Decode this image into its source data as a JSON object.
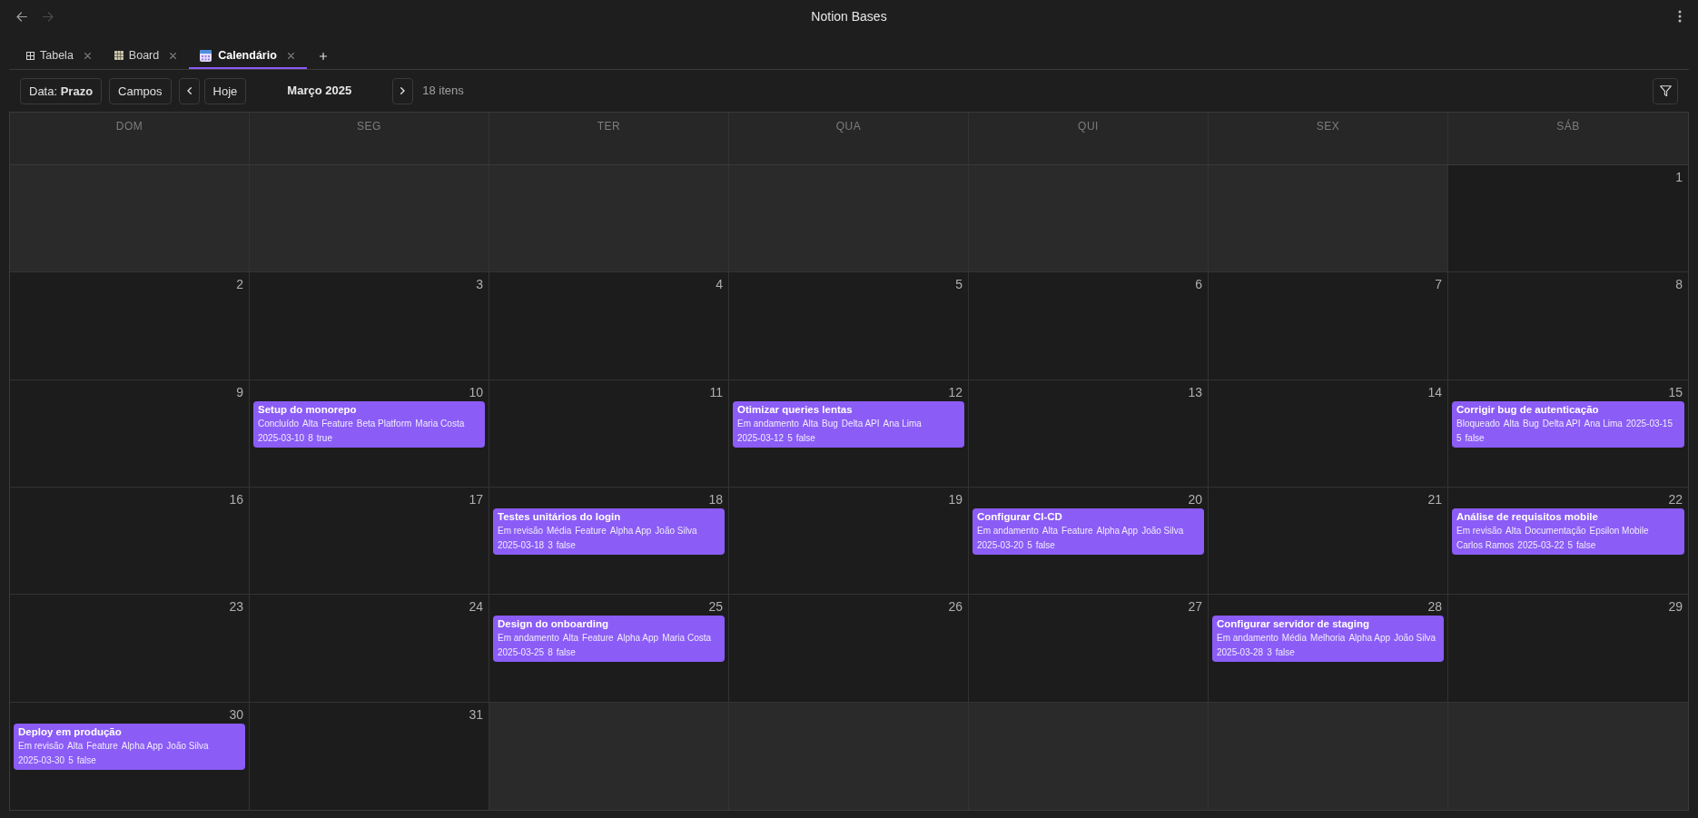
{
  "window": {
    "title": "Notion Bases"
  },
  "navigation": {
    "back": {
      "disabled": false
    },
    "forward": {
      "disabled": true
    }
  },
  "tabs": [
    {
      "label": "Tabela",
      "kind": "table",
      "selected": false
    },
    {
      "label": "Board",
      "kind": "board",
      "selected": false
    },
    {
      "label": "Calendário",
      "kind": "calendar",
      "selected": true
    }
  ],
  "toolbar": {
    "date_property_button": "Data: **Prazo**",
    "fields_button": "Campos",
    "today_button": "Hoje",
    "month_label": "Março 2025",
    "item_count": "18 itens"
  },
  "calendar": {
    "weekdays": [
      "DOM",
      "SEG",
      "TER",
      "QUA",
      "QUI",
      "SEX",
      "SÁB"
    ],
    "weeks": [
      [
        {
          "in_month": false
        },
        {
          "in_month": false
        },
        {
          "in_month": false
        },
        {
          "in_month": false
        },
        {
          "in_month": false
        },
        {
          "in_month": false
        },
        {
          "in_month": true,
          "day": "1"
        }
      ],
      [
        {
          "in_month": true,
          "day": "2"
        },
        {
          "in_month": true,
          "day": "3"
        },
        {
          "in_month": true,
          "day": "4"
        },
        {
          "in_month": true,
          "day": "5"
        },
        {
          "in_month": true,
          "day": "6"
        },
        {
          "in_month": true,
          "day": "7"
        },
        {
          "in_month": true,
          "day": "8"
        }
      ],
      [
        {
          "in_month": true,
          "day": "9"
        },
        {
          "in_month": true,
          "day": "10",
          "events": [
            {
              "title": "Setup do monorepo",
              "properties": [
                "Concluído",
                "Alta",
                "Feature",
                "Beta Platform",
                "Maria Costa",
                "2025-03-10",
                "8",
                "true"
              ]
            }
          ]
        },
        {
          "in_month": true,
          "day": "11"
        },
        {
          "in_month": true,
          "day": "12",
          "events": [
            {
              "title": "Otimizar queries lentas",
              "properties": [
                "Em andamento",
                "Alta",
                "Bug",
                "Delta API",
                "Ana Lima",
                "2025-03-12",
                "5",
                "false"
              ]
            }
          ]
        },
        {
          "in_month": true,
          "day": "13"
        },
        {
          "in_month": true,
          "day": "14"
        },
        {
          "in_month": true,
          "day": "15",
          "events": [
            {
              "title": "Corrigir bug de autenticação",
              "properties": [
                "Bloqueado",
                "Alta",
                "Bug",
                "Delta API",
                "Ana Lima",
                "2025-03-15",
                "5",
                "false"
              ]
            }
          ]
        }
      ],
      [
        {
          "in_month": true,
          "day": "16"
        },
        {
          "in_month": true,
          "day": "17"
        },
        {
          "in_month": true,
          "day": "18",
          "events": [
            {
              "title": "Testes unitários do login",
              "properties": [
                "Em revisão",
                "Média",
                "Feature",
                "Alpha App",
                "João Silva",
                "2025-03-18",
                "3",
                "false"
              ]
            }
          ]
        },
        {
          "in_month": true,
          "day": "19"
        },
        {
          "in_month": true,
          "day": "20",
          "events": [
            {
              "title": "Configurar CI-CD",
              "properties": [
                "Em andamento",
                "Alta",
                "Feature",
                "Alpha App",
                "João Silva",
                "2025-03-20",
                "5",
                "false"
              ]
            }
          ]
        },
        {
          "in_month": true,
          "day": "21"
        },
        {
          "in_month": true,
          "day": "22",
          "events": [
            {
              "title": "Análise de requisitos mobile",
              "properties": [
                "Em revisão",
                "Alta",
                "Documentação",
                "Epsilon Mobile",
                "Carlos Ramos",
                "2025-03-22",
                "5",
                "false"
              ]
            }
          ]
        }
      ],
      [
        {
          "in_month": true,
          "day": "23"
        },
        {
          "in_month": true,
          "day": "24"
        },
        {
          "in_month": true,
          "day": "25",
          "events": [
            {
              "title": "Design do onboarding",
              "properties": [
                "Em andamento",
                "Alta",
                "Feature",
                "Alpha App",
                "Maria Costa",
                "2025-03-25",
                "8",
                "false"
              ]
            }
          ]
        },
        {
          "in_month": true,
          "day": "26"
        },
        {
          "in_month": true,
          "day": "27"
        },
        {
          "in_month": true,
          "day": "28",
          "events": [
            {
              "title": "Configurar servidor de staging",
              "properties": [
                "Em andamento",
                "Média",
                "Melhoria",
                "Alpha App",
                "João Silva",
                "2025-03-28",
                "3",
                "false"
              ]
            }
          ]
        },
        {
          "in_month": true,
          "day": "29"
        }
      ],
      [
        {
          "in_month": true,
          "day": "30",
          "events": [
            {
              "title": "Deploy em produção",
              "properties": [
                "Em revisão",
                "Alta",
                "Feature",
                "Alpha App",
                "João Silva",
                "2025-03-30",
                "5",
                "false"
              ]
            }
          ]
        },
        {
          "in_month": true,
          "day": "31"
        },
        {
          "in_month": false
        },
        {
          "in_month": false
        },
        {
          "in_month": false
        },
        {
          "in_month": false
        },
        {
          "in_month": false
        }
      ]
    ]
  }
}
